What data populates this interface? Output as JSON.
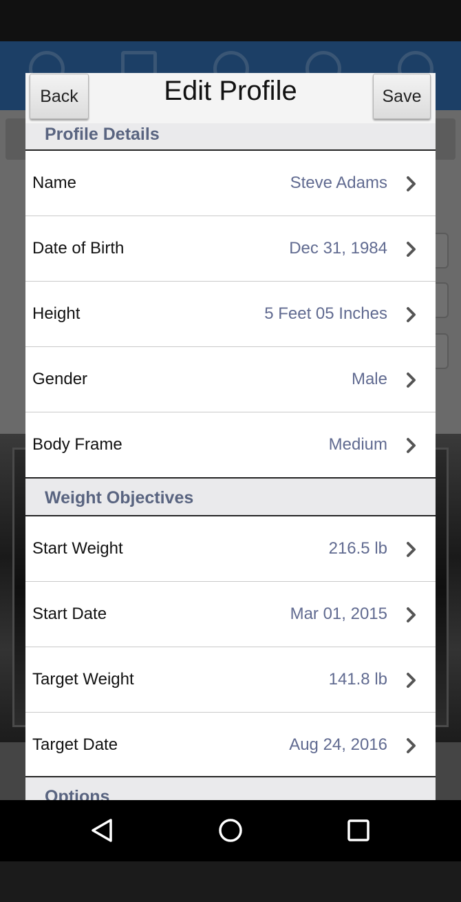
{
  "dialog": {
    "title": "Edit Profile",
    "back_label": "Back",
    "save_label": "Save"
  },
  "sections": {
    "profile_details": "Profile Details",
    "weight_objectives": "Weight Objectives",
    "options": "Options"
  },
  "profile_rows": [
    {
      "label": "Name",
      "value": "Steve Adams"
    },
    {
      "label": "Date of Birth",
      "value": "Dec 31, 1984"
    },
    {
      "label": "Height",
      "value": "5 Feet 05 Inches"
    },
    {
      "label": "Gender",
      "value": "Male"
    },
    {
      "label": "Body Frame",
      "value": "Medium"
    }
  ],
  "weight_rows": [
    {
      "label": "Start Weight",
      "value": "216.5 lb"
    },
    {
      "label": "Start Date",
      "value": "Mar 01, 2015"
    },
    {
      "label": "Target Weight",
      "value": "141.8 lb"
    },
    {
      "label": "Target Date",
      "value": "Aug 24, 2016"
    }
  ],
  "icons": {
    "row_chevron": "chevron-right-icon",
    "nav_back": "triangle-back-icon",
    "nav_home": "circle-home-icon",
    "nav_recents": "square-recents-icon"
  },
  "colors": {
    "value_text": "#606a90",
    "section_text": "#596480",
    "toolbar_bg": "#1c3f66"
  }
}
